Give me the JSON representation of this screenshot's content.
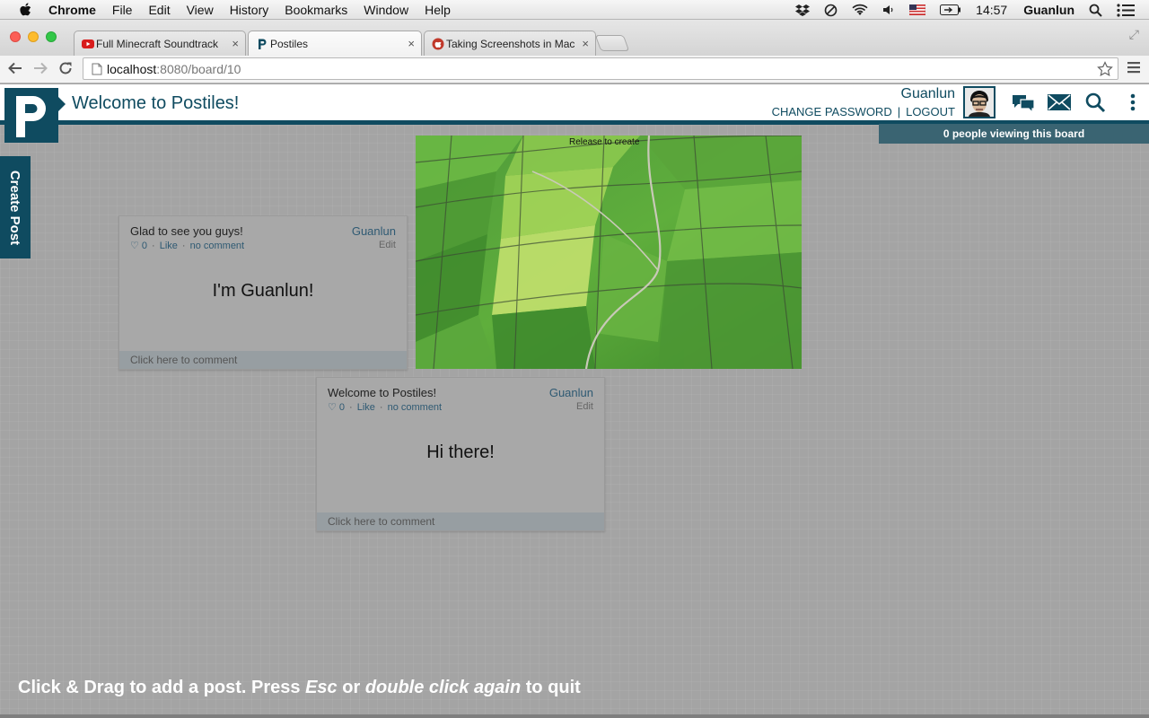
{
  "menubar": {
    "app": "Chrome",
    "items": [
      "File",
      "Edit",
      "View",
      "History",
      "Bookmarks",
      "Window",
      "Help"
    ],
    "clock": "14:57",
    "user": "Guanlun"
  },
  "tabs": [
    {
      "label": "Full Minecraft Soundtrack",
      "icon": "youtube-icon"
    },
    {
      "label": "Postiles",
      "icon": "postiles-icon"
    },
    {
      "label": "Taking Screenshots in Mac",
      "icon": "apple-support-icon"
    }
  ],
  "address": {
    "host": "localhost",
    "rest": ":8080/board/10"
  },
  "app": {
    "title": "Welcome to Postiles!",
    "user_name": "Guanlun",
    "change_password": "CHANGE PASSWORD",
    "logout": "LOGOUT",
    "viewers": "0 people viewing this board",
    "create_post": "Create Post",
    "accent": "#0f4b60"
  },
  "posts": [
    {
      "title": "Glad to see you guys!",
      "author": "Guanlun",
      "likes": "♡ 0",
      "like": "Like",
      "comments": "no comment",
      "edit": "Edit",
      "body": "I'm Guanlun!",
      "comment_prompt": "Click here to comment"
    },
    {
      "title": "Welcome to Postiles!",
      "author": "Guanlun",
      "likes": "♡ 0",
      "like": "Like",
      "comments": "no comment",
      "edit": "Edit",
      "body": "Hi there!",
      "comment_prompt": "Click here to comment"
    }
  ],
  "release_text": "Release to create",
  "hint": {
    "part1": "Click & Drag to add a post. Press ",
    "esc": "Esc",
    "part2": " or ",
    "dbl": "double click again",
    "part3": " to quit"
  }
}
